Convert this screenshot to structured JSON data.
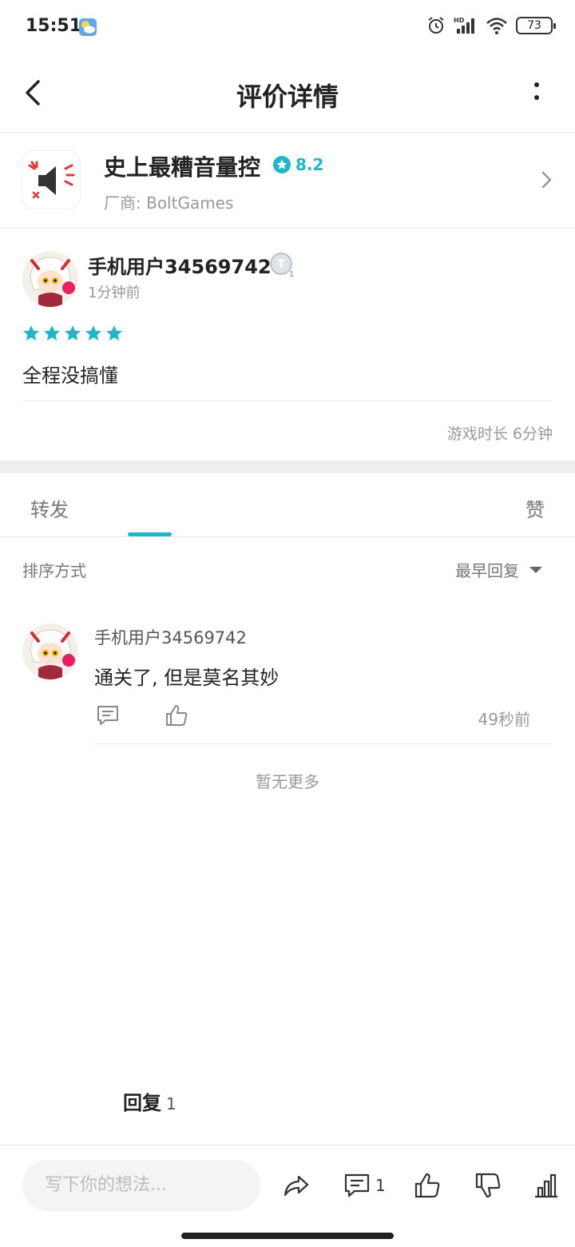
{
  "status": {
    "time": "15:51",
    "battery": "73"
  },
  "header": {
    "title": "评价详情"
  },
  "game": {
    "name": "史上最糟音量控",
    "score": "8.2",
    "vendor": "厂商: BoltGames"
  },
  "review": {
    "username": "手机用户34569742",
    "time": "1分钟前",
    "rating": 5,
    "content": "全程没搞懂",
    "playtime": "游戏时长 6分钟"
  },
  "tabs": {
    "forward": "转发",
    "reply": "回复",
    "reply_count": "1",
    "like": "赞"
  },
  "sort": {
    "label": "排序方式",
    "value": "最早回复"
  },
  "reply": {
    "username": "手机用户34569742",
    "content": "通关了, 但是莫名其妙",
    "time": "49秒前"
  },
  "no_more": "暂无更多",
  "bottom": {
    "placeholder": "写下你的想法...",
    "comment_count": "1"
  },
  "colors": {
    "accent": "#1fb7c8",
    "text": "#222222",
    "muted": "#999999"
  }
}
